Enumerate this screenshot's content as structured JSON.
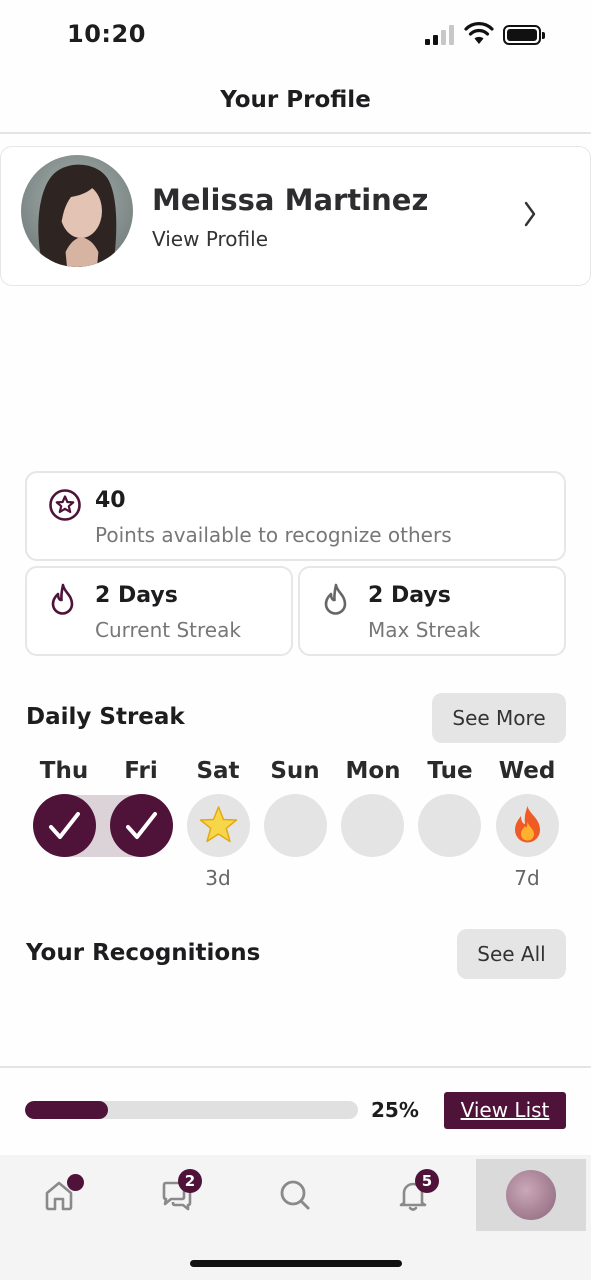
{
  "status_bar": {
    "time": "10:20"
  },
  "header": {
    "title": "Your Profile"
  },
  "profile": {
    "name": "Melissa Martinez",
    "link_label": "View Profile"
  },
  "points": {
    "value": "40",
    "label": "Points available to recognize others"
  },
  "current_streak": {
    "value": "2 Days",
    "label": "Current Streak"
  },
  "max_streak": {
    "value": "2 Days",
    "label": "Max Streak"
  },
  "daily_streak": {
    "title": "Daily Streak",
    "see_more_label": "See More",
    "days": [
      {
        "label": "Thu",
        "state": "done",
        "sub": ""
      },
      {
        "label": "Fri",
        "state": "done",
        "sub": ""
      },
      {
        "label": "Sat",
        "state": "star",
        "sub": "3d"
      },
      {
        "label": "Sun",
        "state": "empty",
        "sub": ""
      },
      {
        "label": "Mon",
        "state": "empty",
        "sub": ""
      },
      {
        "label": "Tue",
        "state": "empty",
        "sub": ""
      },
      {
        "label": "Wed",
        "state": "fire",
        "sub": "7d"
      }
    ]
  },
  "recognitions": {
    "title": "Your Recognitions",
    "see_all_label": "See All"
  },
  "progress": {
    "percent_label": "25%",
    "fraction": 0.25,
    "view_list_label": "View List"
  },
  "tab_bar": {
    "items": [
      {
        "icon": "home-icon",
        "badge": "dot"
      },
      {
        "icon": "chat-icon",
        "badge": "2"
      },
      {
        "icon": "search-icon",
        "badge": ""
      },
      {
        "icon": "bell-icon",
        "badge": "5"
      },
      {
        "icon": "avatar",
        "badge": "",
        "active": true
      }
    ]
  },
  "colors": {
    "accent": "#4f1238",
    "pill_bg": "#e5e5e5",
    "muted_text": "#777777"
  }
}
